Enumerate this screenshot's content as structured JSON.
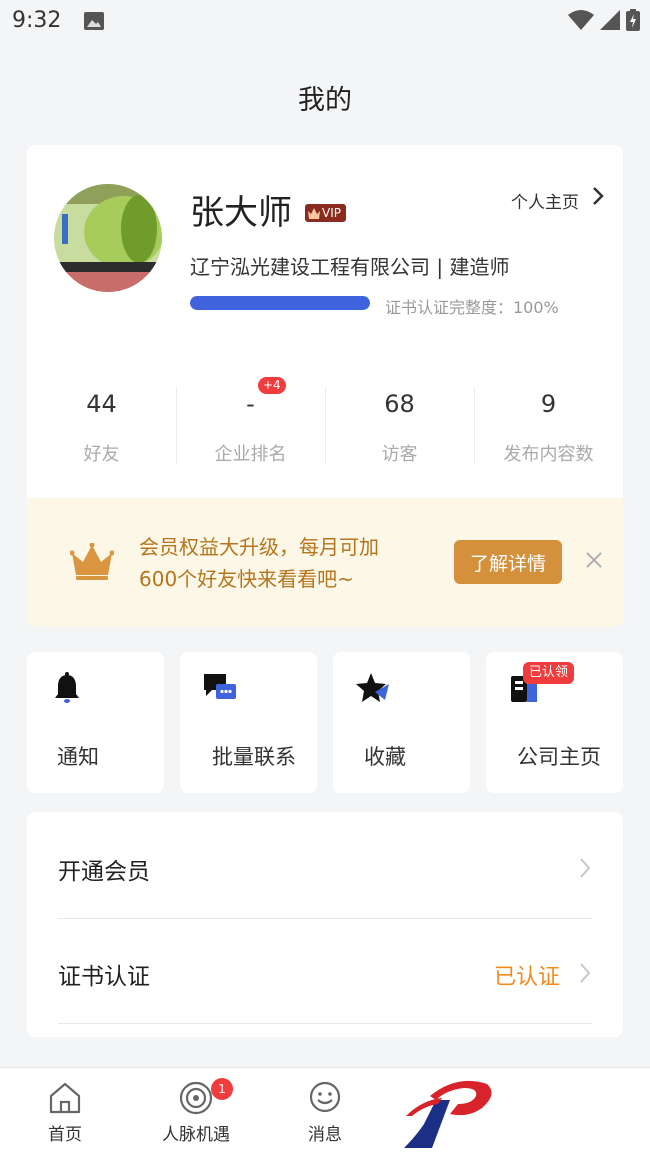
{
  "status_bar": {
    "time": "9:32"
  },
  "header": {
    "title": "我的"
  },
  "profile": {
    "name": "张大师",
    "vip_label": "VIP",
    "homepage_link": "个人主页",
    "company_role": "辽宁泓光建设工程有限公司 | 建造师",
    "cert_progress_label": "证书认证完整度：100%",
    "cert_progress_value": 1.0
  },
  "stats": [
    {
      "value": "44",
      "label": "好友"
    },
    {
      "value": "-",
      "label": "企业排名"
    },
    {
      "value": "68",
      "label": "访客",
      "badge": "+4"
    },
    {
      "value": "9",
      "label": "发布内容数"
    }
  ],
  "promo": {
    "line1": "会员权益大升级，每月可加",
    "line2": "600个好友快来看看吧~",
    "button": "了解详情"
  },
  "quick_actions": [
    {
      "label": "通知",
      "icon": "bell-icon"
    },
    {
      "label": "批量联系",
      "icon": "chat-icon"
    },
    {
      "label": "收藏",
      "icon": "star-icon"
    },
    {
      "label": "公司主页",
      "icon": "building-icon",
      "badge": "已认领"
    }
  ],
  "menu": [
    {
      "label": "开通会员",
      "value": ""
    },
    {
      "label": "证书认证",
      "value": "已认证"
    }
  ],
  "tabbar": [
    {
      "label": "首页",
      "icon": "home-icon"
    },
    {
      "label": "人脉机遇",
      "icon": "network-icon",
      "badge": "1"
    },
    {
      "label": "消息",
      "icon": "message-icon"
    }
  ],
  "colors": {
    "accent": "#3e63dc",
    "promo_text": "#b5751c",
    "promo_button": "#d4903b",
    "badge_red": "#f03c3c",
    "verified": "#f08c1e"
  }
}
